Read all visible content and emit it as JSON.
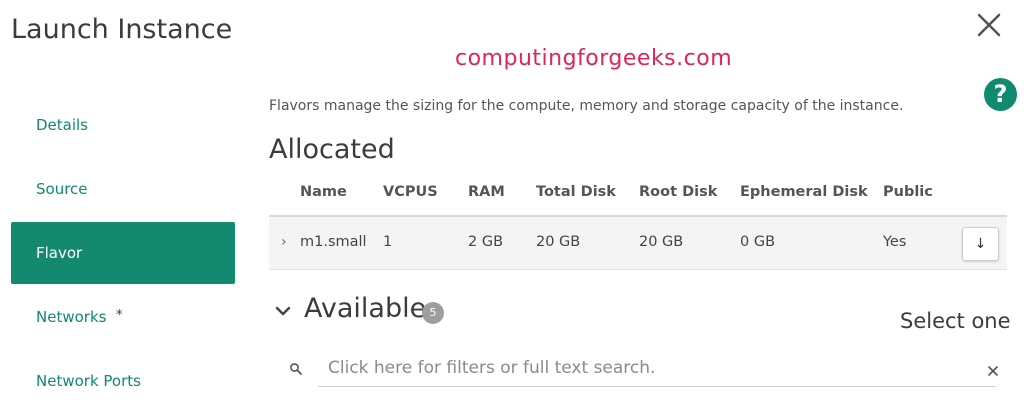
{
  "dialog": {
    "title": "Launch Instance",
    "watermark": "computingforgeeks.com",
    "help_label": "?"
  },
  "sidebar": {
    "items": [
      {
        "label": "Details",
        "active": false
      },
      {
        "label": "Source",
        "active": false
      },
      {
        "label": "Flavor",
        "active": true
      },
      {
        "label": "Networks",
        "active": false,
        "required_mark": "*"
      },
      {
        "label": "Network Ports",
        "active": false
      }
    ]
  },
  "main": {
    "description": "Flavors manage the sizing for the compute, memory and storage capacity of the instance.",
    "allocated": {
      "heading": "Allocated",
      "columns": [
        "Name",
        "VCPUS",
        "RAM",
        "Total Disk",
        "Root Disk",
        "Ephemeral Disk",
        "Public"
      ],
      "rows": [
        {
          "chevron": "›",
          "name": "m1.small",
          "vcpus": "1",
          "ram": "2 GB",
          "total_disk": "20 GB",
          "root_disk": "20 GB",
          "ephemeral_disk": "0 GB",
          "public": "Yes",
          "action": "↓"
        }
      ]
    },
    "available": {
      "heading": "Available",
      "count": "5",
      "select_hint": "Select one",
      "search_placeholder": "Click here for filters or full text search."
    }
  },
  "colors": {
    "accent": "#138a70",
    "watermark": "#e0245e"
  },
  "icons": {
    "close": "close-icon",
    "help": "help-icon",
    "search": "search-icon",
    "clear": "clear-icon",
    "toggle": "chevron-down-icon",
    "row_expand": "chevron-right-icon",
    "row_action": "arrow-down-icon"
  }
}
